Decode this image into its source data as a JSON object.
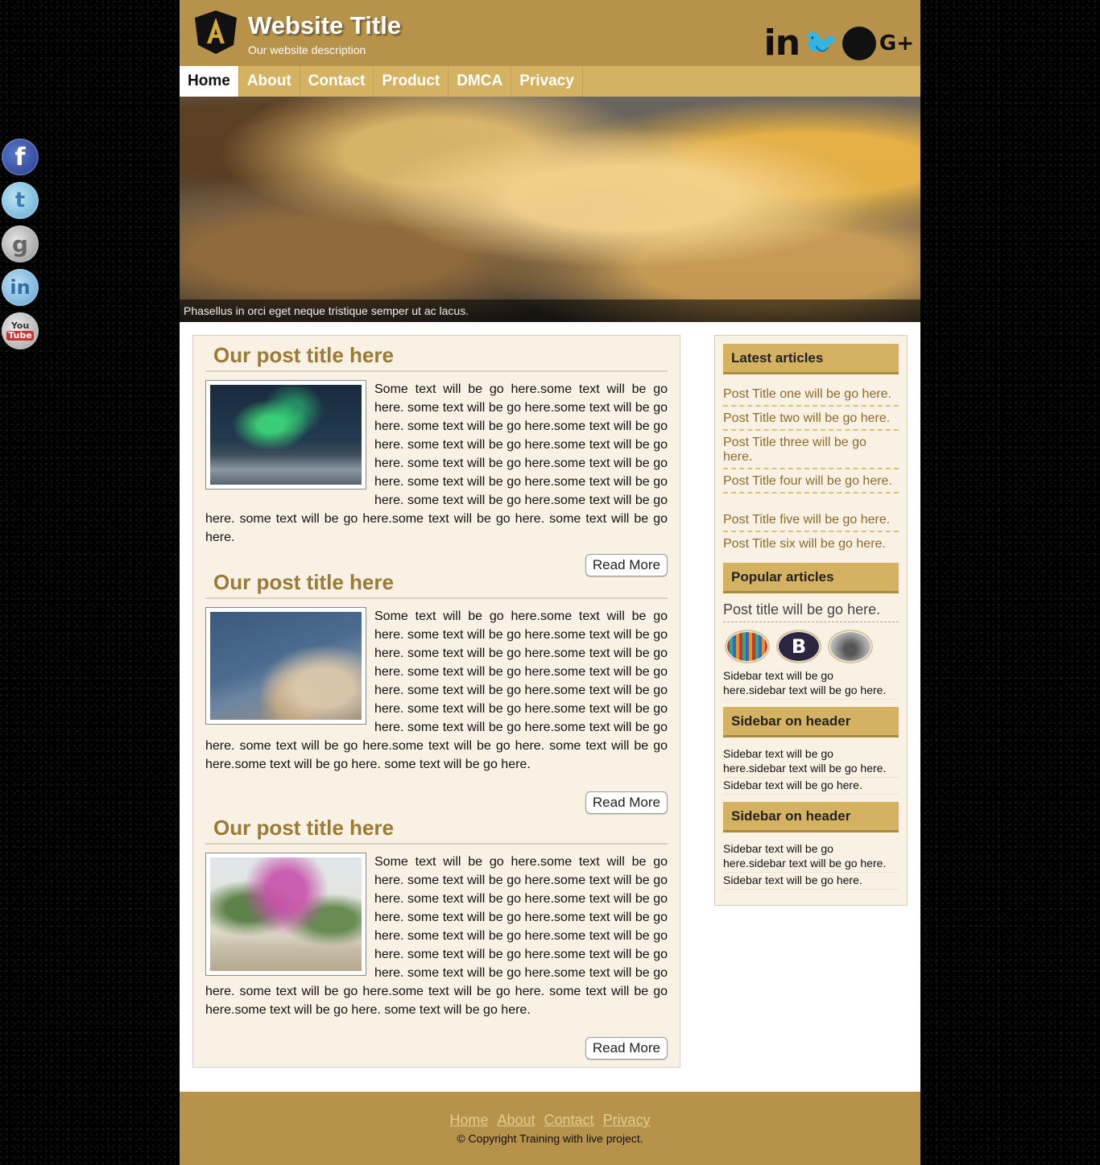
{
  "header": {
    "title": "Website Title",
    "description": "Our website description",
    "social_icons": [
      "linkedin-icon",
      "twitter-icon",
      "firefox-icon",
      "google-plus-icon"
    ]
  },
  "nav": {
    "items": [
      "Home",
      "About",
      "Contact",
      "Product",
      "DMCA",
      "Privacy"
    ],
    "active": "Home"
  },
  "banner": {
    "caption": "Phasellus in orci eget neque tristique semper ut ac lacus."
  },
  "side_social": [
    "facebook-icon",
    "twitter-icon",
    "google-plus-icon",
    "linkedin-icon",
    "youtube-icon"
  ],
  "side_social_text": {
    "youtube_top": "You",
    "youtube_bottom": "Tube"
  },
  "posts": [
    {
      "title": "Our post title here",
      "image": "aurora-photo",
      "body": "Some text will be go here.some text will be go here. some text will be go here.some text will be go here. some text will be go here.some text will be go here. some text will be go here.some text will be go here. some text will be go here.some text will be go here. some text will be go here.some text will be go here. some text will be go here.some text will be go here. some text will be go here.some text will be go here. some text will be go here.",
      "read_more": "Read More"
    },
    {
      "title": "Our post title here",
      "image": "coastal-town-photo",
      "body": "Some text will be go here.some text will be go here. some text will be go here.some text will be go here. some text will be go here.some text will be go here. some text will be go here.some text will be go here. some text will be go here.some text will be go here. some text will be go here.some text will be go here. some text will be go here.some text will be go here. some text will be go here.some text will be go here. some text will be go here.some text will be go here. some text will be go here.",
      "read_more": "Read More"
    },
    {
      "title": "Our post title here",
      "image": "flowering-tree-photo",
      "body": "Some text will be go here.some text will be go here. some text will be go here.some text will be go here. some text will be go here.some text will be go here. some text will be go here.some text will be go here. some text will be go here.some text will be go here. some text will be go here.some text will be go here. some text will be go here.some text will be go here. some text will be go here.some text will be go here. some text will be go here.some text will be go here. some text will be go here.",
      "read_more": "Read More"
    }
  ],
  "sidebar": {
    "latest_heading": "Latest articles",
    "latest": [
      "Post Title one will be go here.",
      "Post Title two will be go here.",
      "Post Title three will be go here.",
      "Post Title four will be go here.",
      "Post Title five will be go here.",
      "Post Title six will be go here."
    ],
    "popular_heading": "Popular articles",
    "popular_link": "Post title will be go here.",
    "popular_icon_letter": "B",
    "popular_text": "Sidebar text will be go here.sidebar text will be go here.",
    "section2_heading": "Sidebar on header",
    "section2_text1": "Sidebar text will be go here.sidebar text will be go here.",
    "section2_text2": "Sidebar text will be go here.",
    "section3_heading": "Sidebar on header",
    "section3_text1": "Sidebar text will be go here.sidebar text will be go here.",
    "section3_text2": "Sidebar text will be go here."
  },
  "footer": {
    "links": [
      "Home",
      "About",
      "Contact",
      "Privacy"
    ],
    "copyright": "© Copyright Training with live project."
  },
  "colors": {
    "header_bg": "#b6924b",
    "nav_bg": "#d4b262",
    "accent_title": "#9c7a35",
    "content_bg": "#f8f1e4"
  }
}
